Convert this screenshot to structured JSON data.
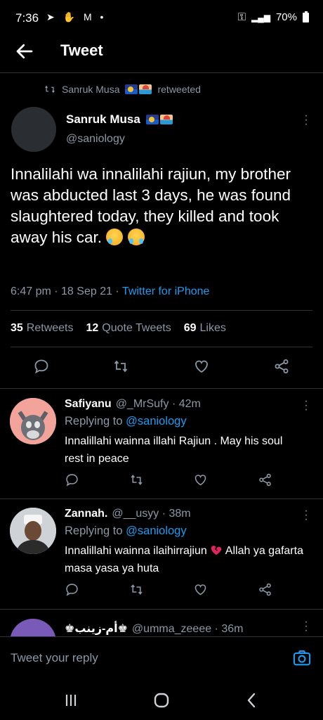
{
  "status": {
    "time": "7:36",
    "left_icons": "➤ ✋ M •",
    "battery": "70%"
  },
  "header": {
    "title": "Tweet"
  },
  "retweet_notice": {
    "user": "Sanruk Musa",
    "action": "retweeted"
  },
  "tweet": {
    "author_name": "Sanruk Musa",
    "author_handle": "@saniology",
    "text": "Innalilahi wa innalilahi rajiun, my brother was abducted last 3 days, he was found slaughtered today, they killed and took away his car.",
    "time": "6:47 pm · 18 Sep 21 · ",
    "source": "Twitter for iPhone",
    "stats": [
      {
        "count": "35",
        "label": "Retweets"
      },
      {
        "count": "12",
        "label": "Quote Tweets"
      },
      {
        "count": "69",
        "label": "Likes"
      }
    ]
  },
  "replies": [
    {
      "name": "Safiyanu",
      "handle": "@_MrSufy · 42m",
      "replying_prefix": "Replying to ",
      "replying_to": "@saniology",
      "text": "Innalillahi wainna illahi Rajiun . May his soul rest in peace"
    },
    {
      "name": "Zannah.",
      "handle": "@__usyy · 38m",
      "replying_prefix": "Replying to ",
      "replying_to": "@saniology",
      "text_a": "Innalillahi wainna ilaihirrajiun",
      "text_b": " Allah ya gafarta masa yasa ya huta"
    },
    {
      "name": "أم-زينب",
      "handle": "@umma_zeeee · 36m"
    }
  ],
  "compose": {
    "placeholder": "Tweet your reply"
  },
  "colors": {
    "accent": "#1d9bf0",
    "muted": "#8b98a5",
    "background": "#000000"
  }
}
